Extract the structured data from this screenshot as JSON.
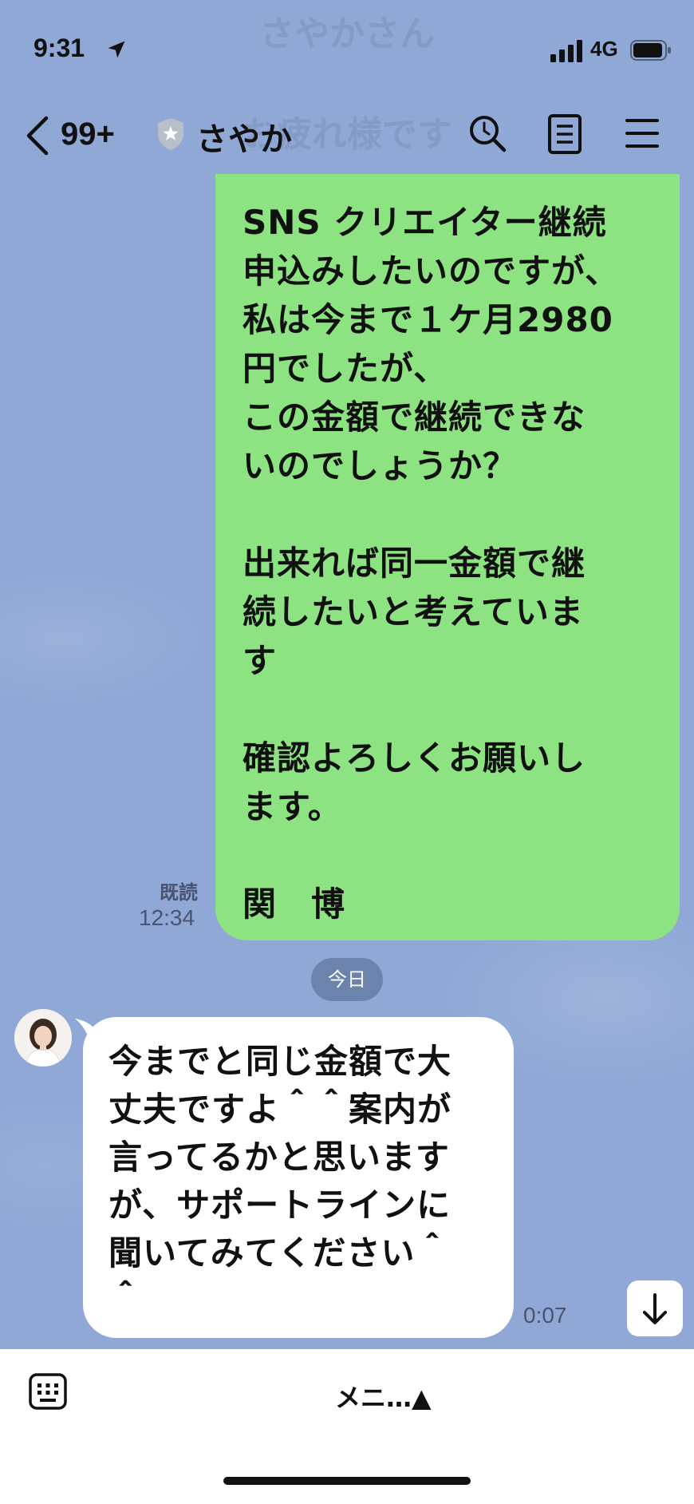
{
  "status_bar": {
    "time": "9:31",
    "network": "4G"
  },
  "ghost": {
    "line1": "さやかさん",
    "line2": "お疲れ様です"
  },
  "nav": {
    "back_count": "99+",
    "chat_name": "さやか"
  },
  "messages": {
    "outgoing": {
      "text": "SNS クリエイター継続\n申込みしたいのですが、\n私は今まで１ケ月2980\n円でしたが、\nこの金額で継続できな\nいのでしょうか？\n\n出来れば同一金額で継\n続したいと考えていま\nす\n\n確認よろしくお願いし\nます。\n\n関　博",
      "read_label": "既読",
      "time": "12:34"
    },
    "date_separator": "今日",
    "incoming": {
      "text": "今までと同じ金額で大\n丈夫ですよ＾＾案内が\n言ってるかと思います\nが、サポートラインに\n聞いてみてください＾\n＾",
      "time": "0:07"
    }
  },
  "bottom": {
    "menu_label": "メニ…▲"
  },
  "colors": {
    "background": "#8fa8d6",
    "outgoing_bubble": "#8de282",
    "incoming_bubble": "#ffffff"
  }
}
